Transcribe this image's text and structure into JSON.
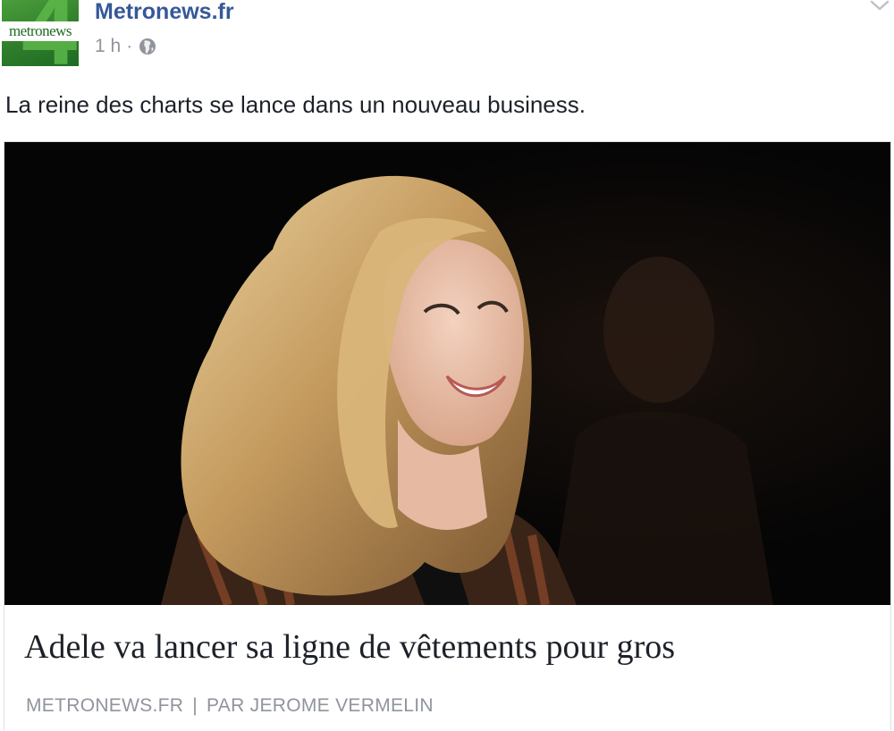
{
  "post": {
    "page_name": "Metronews.fr",
    "logo_text": "metronews",
    "logo_numeral": "4",
    "timestamp": "1 h",
    "separator": "·",
    "audience_icon": "globe-icon",
    "options_icon": "chevron-down-icon",
    "message": "La reine des charts se lance dans un nouveau business."
  },
  "link_card": {
    "image_alt": "Adele",
    "title": "Adele va lancer sa ligne de vêtements pour gros",
    "domain": "METRONEWS.FR",
    "divider": "|",
    "byline": "PAR JEROME VERMELIN"
  },
  "colors": {
    "page_name": "#365899",
    "meta_text": "#90949c",
    "body_text": "#1d2129",
    "logo_green": "#2f7d2b",
    "card_border": "#dddfe2"
  }
}
